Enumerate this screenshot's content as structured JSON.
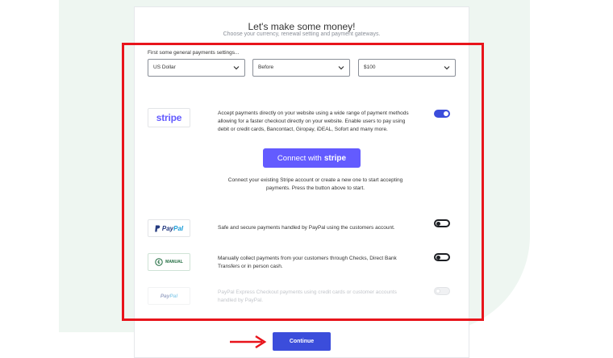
{
  "header": {
    "title": "Let's make some money!",
    "subtitle": "Choose your currency, renewal setting and payment gateways."
  },
  "settings": {
    "label": "First some general payments settings...",
    "currency": "US Dollar",
    "position": "Before",
    "format": "$100"
  },
  "gateways": {
    "stripe": {
      "logo": "stripe",
      "description": "Accept payments directly on your website using a wide range of payment methods allowing for a faster checkout directly on your website. Enable users to pay using debit or credit cards, Bancontact, Giropay, iDEAL, Sofort and many more.",
      "connect_label": "Connect with",
      "connect_brand": "stripe",
      "connect_note": "Connect your existing Stripe account or create a new one to start accepting payments. Press the button above to start.",
      "enabled": true
    },
    "paypal": {
      "logo_a": "Pay",
      "logo_b": "Pal",
      "description": "Safe and secure payments handled by PayPal using the customers account.",
      "enabled": false
    },
    "manual": {
      "logo": "MANUAL",
      "description": "Manually collect payments from your customers through Checks, Direct Bank Transfers or in person cash.",
      "enabled": false
    },
    "paypal_express": {
      "logo_a": "Pay",
      "logo_b": "Pal",
      "description": "PayPal Express Checkout payments using credit cards or customer accounts handled by PayPal.",
      "enabled": false,
      "disabled": true
    }
  },
  "footer": {
    "continue_label": "Continue"
  },
  "colors": {
    "accent": "#3b4ddb",
    "stripe": "#635bff",
    "highlight": "#e8141b",
    "background_shape": "#eef6f1"
  }
}
